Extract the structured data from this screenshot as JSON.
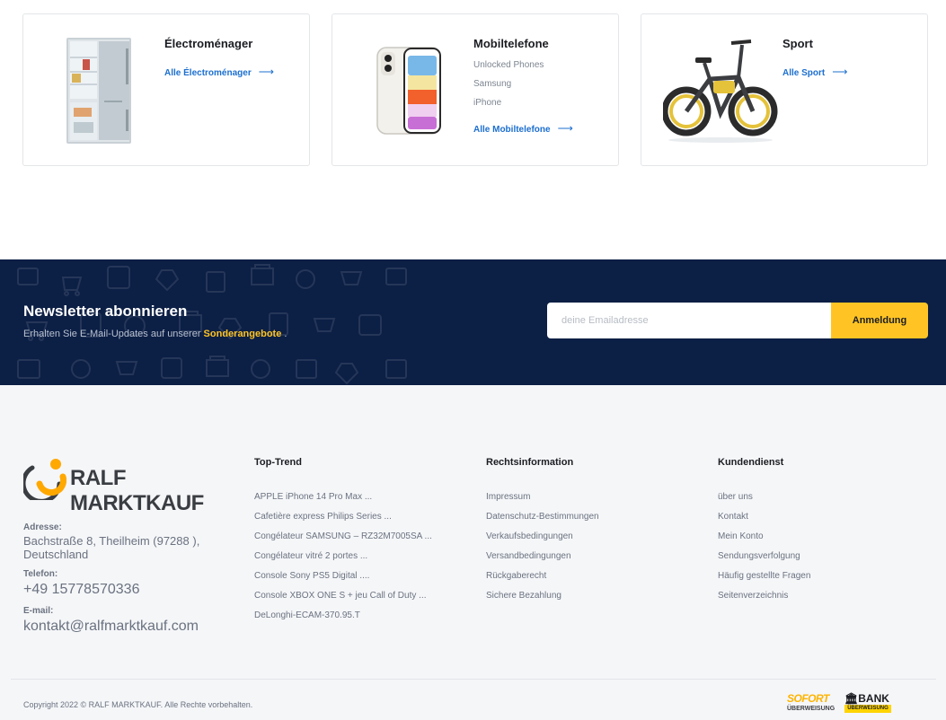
{
  "categories": [
    {
      "title": "Électroménager",
      "subs": [],
      "more": "Alle Électroménager",
      "image": "fridge"
    },
    {
      "title": "Mobiltelefone",
      "subs": [
        "Unlocked Phones",
        "Samsung",
        "iPhone"
      ],
      "more": "Alle Mobiltelefone",
      "image": "smartphone"
    },
    {
      "title": "Sport",
      "subs": [],
      "more": "Alle Sport",
      "image": "e-bike"
    }
  ],
  "newsletter": {
    "title": "Newsletter abonnieren",
    "text": "Erhalten Sie E-Mail-Updates auf unserer",
    "highlight": "Sonderangebote",
    "suffix": ".",
    "placeholder": "deine Emailadresse",
    "button": "Anmeldung"
  },
  "footer": {
    "brand": "RALF MARKTKAUF",
    "address_label": "Adresse:",
    "address": "Bachstraße 8, Theilheim (97288 ), Deutschland",
    "phone_label": "Telefon:",
    "phone": "+49 15778570336",
    "email_label": "E-mail:",
    "email": "kontakt@ralfmarktkauf.com",
    "columns": [
      {
        "title": "Top-Trend",
        "links": [
          "APPLE iPhone 14 Pro Max ...",
          "Cafetière express Philips Series ...",
          "Congélateur SAMSUNG – RZ32M7005SA ...",
          "Congélateur vitré 2 portes ...",
          "Console Sony PS5 Digital ....",
          "Console XBOX ONE S + jeu Call of Duty ...",
          "DeLonghi-ECAM-370.95.T"
        ]
      },
      {
        "title": "Rechtsinformation",
        "links": [
          "Impressum",
          "Datenschutz-Bestimmungen",
          "Verkaufsbedingungen",
          "Versandbedingungen",
          "Rückgaberecht",
          "Sichere Bezahlung"
        ]
      },
      {
        "title": "Kundendienst",
        "links": [
          "über uns",
          "Kontakt",
          "Mein Konto",
          "Sendungsverfolgung",
          "Häufig gestellte Fragen",
          "Seitenverzeichnis"
        ]
      }
    ],
    "copyright": "Copyright 2022 © RALF MARKTKAUF. Alle Rechte vorbehalten.",
    "payments": {
      "sofort_top": "SOFORT",
      "sofort_bottom": "ÜBERWEISUNG",
      "bank_top": "BANK",
      "bank_bottom": "ÜBERWEISUNG"
    }
  },
  "colors": {
    "accent": "#ffc424",
    "link": "#1c6fcf",
    "newsletter_bg": "#0c1f45",
    "footer_bg": "#f5f6f8"
  }
}
